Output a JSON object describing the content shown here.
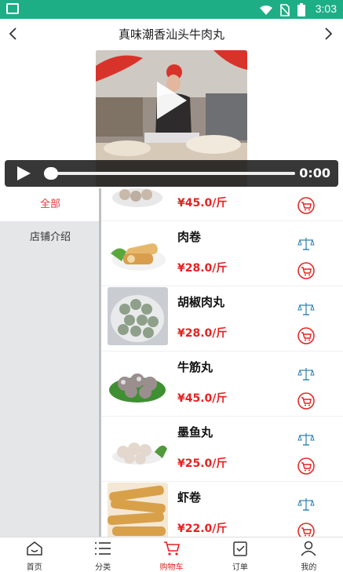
{
  "status_bar": {
    "time": "3:03"
  },
  "header": {
    "title": "真味潮香汕头牛肉丸"
  },
  "video": {
    "time": "0:00"
  },
  "sidebar": {
    "items": [
      {
        "label": "全部"
      },
      {
        "label": "店铺介绍"
      }
    ]
  },
  "products": [
    {
      "name": "",
      "price": "¥45.0/斤"
    },
    {
      "name": "肉卷",
      "price": "¥28.0/斤"
    },
    {
      "name": "胡椒肉丸",
      "price": "¥28.0/斤"
    },
    {
      "name": "牛筋丸",
      "price": "¥45.0/斤"
    },
    {
      "name": "墨鱼丸",
      "price": "¥25.0/斤"
    },
    {
      "name": "虾卷",
      "price": "¥22.0/斤"
    }
  ],
  "tabbar": {
    "items": [
      {
        "label": "首页"
      },
      {
        "label": "分类"
      },
      {
        "label": "购物车"
      },
      {
        "label": "订单"
      },
      {
        "label": "我的"
      }
    ]
  },
  "colors": {
    "accent": "#e62222",
    "status_bar": "#1eae86"
  }
}
